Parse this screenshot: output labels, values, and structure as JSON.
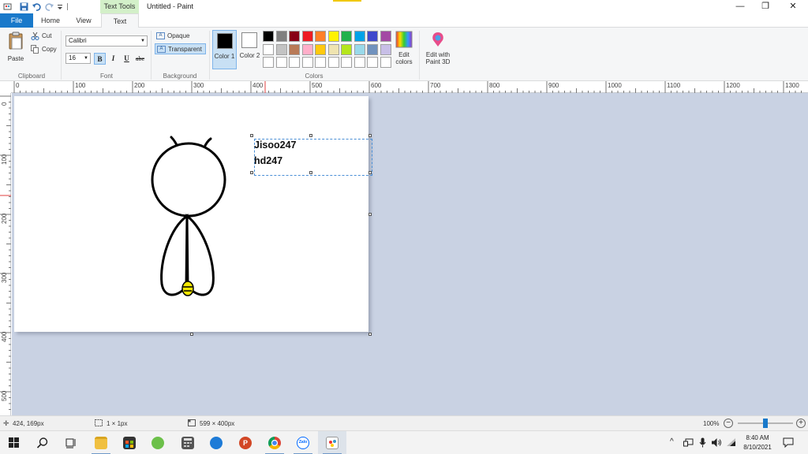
{
  "window": {
    "title": "Untitled - Paint",
    "context_tab": "Text Tools",
    "minimize": "—",
    "restore": "❐",
    "close": "✕"
  },
  "tabs": {
    "file": "File",
    "home": "Home",
    "view": "View",
    "text": "Text"
  },
  "ribbon": {
    "clipboard": {
      "paste": "Paste",
      "cut": "Cut",
      "copy": "Copy",
      "group": "Clipboard"
    },
    "font": {
      "family": "Calibri",
      "size": "16",
      "bold": "B",
      "italic": "I",
      "underline": "U",
      "strikethrough": "abc",
      "group": "Font"
    },
    "background": {
      "opaque": "Opaque",
      "transparent": "Transparent",
      "group": "Background"
    },
    "colors": {
      "color1_label": "Color 1",
      "color1_value": "#000000",
      "color2_label": "Color 2",
      "color2_value": "#ffffff",
      "edit_colors": "Edit colors",
      "edit_paint3d": "Edit with Paint 3D",
      "group": "Colors",
      "palette_row1": [
        "#000000",
        "#7f7f7f",
        "#880015",
        "#ed1c24",
        "#ff7f27",
        "#fff200",
        "#22b14c",
        "#00a2e8",
        "#3f48cc",
        "#a349a4"
      ],
      "palette_row2": [
        "#ffffff",
        "#c3c3c3",
        "#b97a57",
        "#ffaec9",
        "#ffc90e",
        "#efe4b0",
        "#b5e61d",
        "#99d9ea",
        "#7092be",
        "#c8bfe7"
      ],
      "palette_row3": [
        "#ffffff",
        "#ffffff",
        "#ffffff",
        "#ffffff",
        "#ffffff",
        "#ffffff",
        "#ffffff",
        "#ffffff",
        "#ffffff",
        "#ffffff"
      ]
    }
  },
  "ruler": {
    "top": [
      "0",
      "100",
      "200",
      "300",
      "400",
      "500",
      "600",
      "700",
      "800",
      "900",
      "1000",
      "1100",
      "1200",
      "1300"
    ],
    "left": [
      "0",
      "100",
      "200",
      "300",
      "400",
      "500"
    ]
  },
  "canvas": {
    "text_lines": [
      "Jisoo247",
      "hd247"
    ]
  },
  "statusbar": {
    "cursor": "424, 169px",
    "selection": "1 × 1px",
    "image_size": "599 × 400px",
    "zoom": "100%",
    "zoom_level": 0.5
  },
  "taskbar": {
    "time": "8:40 AM",
    "date": "8/10/2021",
    "zalo": "Zalo"
  }
}
